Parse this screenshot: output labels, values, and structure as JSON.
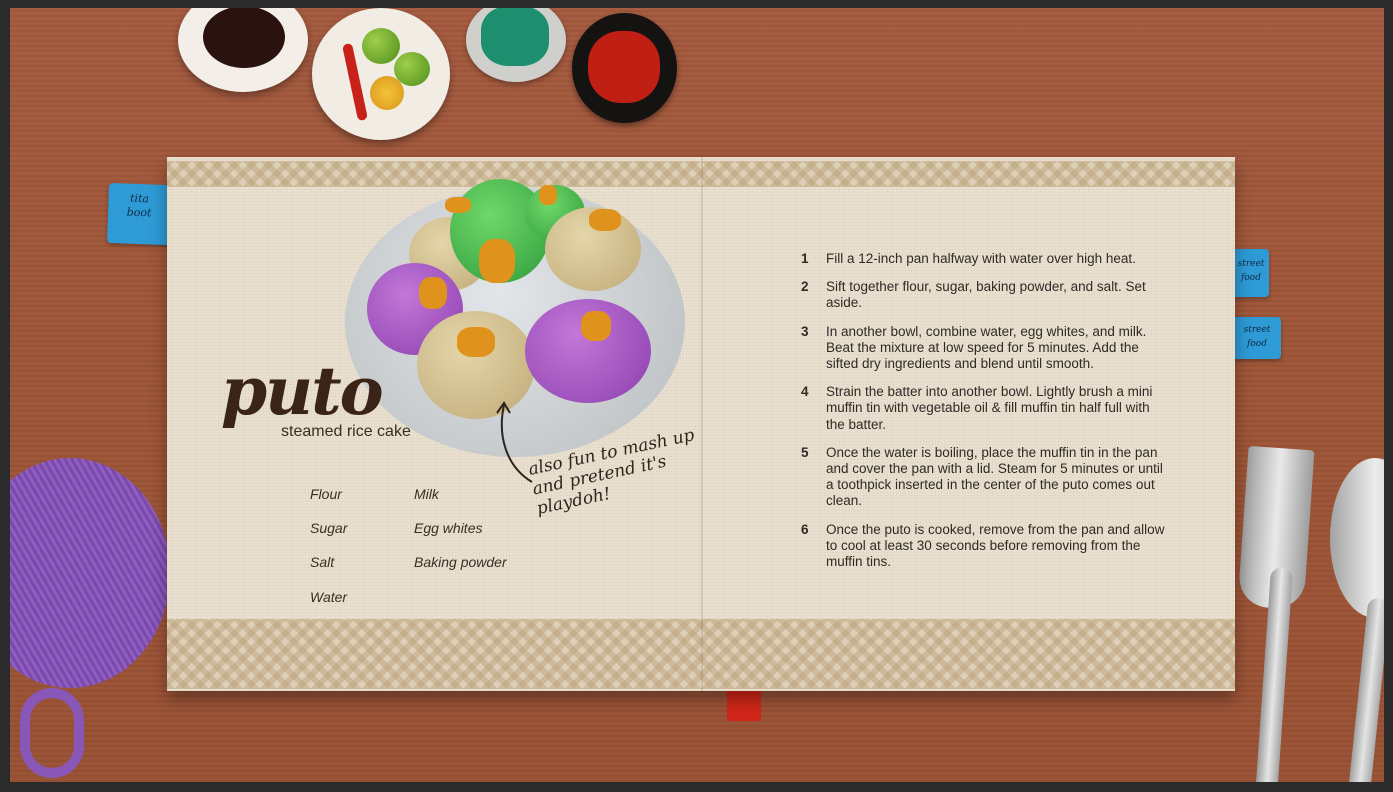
{
  "tabs": {
    "left": "tita\nboot",
    "right_1": "street\nfood",
    "right_2": "street\nfood"
  },
  "recipe": {
    "title": "puto",
    "subtitle": "steamed rice cake",
    "note": "also fun to mash up and pretend it's playdoh!",
    "ingredients_col1": [
      "Flour",
      "Sugar",
      "Salt",
      "Water"
    ],
    "ingredients_col2": [
      "Milk",
      "Egg whites",
      "Baking powder"
    ],
    "steps": [
      {
        "num": "1",
        "text": "Fill a 12-inch pan halfway with water over high heat."
      },
      {
        "num": "2",
        "text": "Sift together flour, sugar, baking powder, and salt. Set aside."
      },
      {
        "num": "3",
        "text": "In another bowl, combine water, egg whites, and milk. Beat the mixture at low speed for 5 minutes. Add the sifted dry ingredients and blend until smooth."
      },
      {
        "num": "4",
        "text": "Strain the batter into another bowl. Lightly brush a mini muffin tin with vegetable oil & fill muffin tin half full with the batter."
      },
      {
        "num": "5",
        "text": "Once the water is boiling, place the muffin tin in the pan and cover the pan with a lid. Steam for 5 minutes or until a toothpick inserted in the center of the puto comes out clean."
      },
      {
        "num": "6",
        "text": "Once the puto is cooked, remove from the pan and allow to cool at least 30 seconds before removing from the muffin tins."
      }
    ]
  },
  "colors": {
    "table": "#a45a3e",
    "paper": "#e9e0cf",
    "tab_blue": "#2e9bd6",
    "ribbon_red": "#d1261a"
  }
}
